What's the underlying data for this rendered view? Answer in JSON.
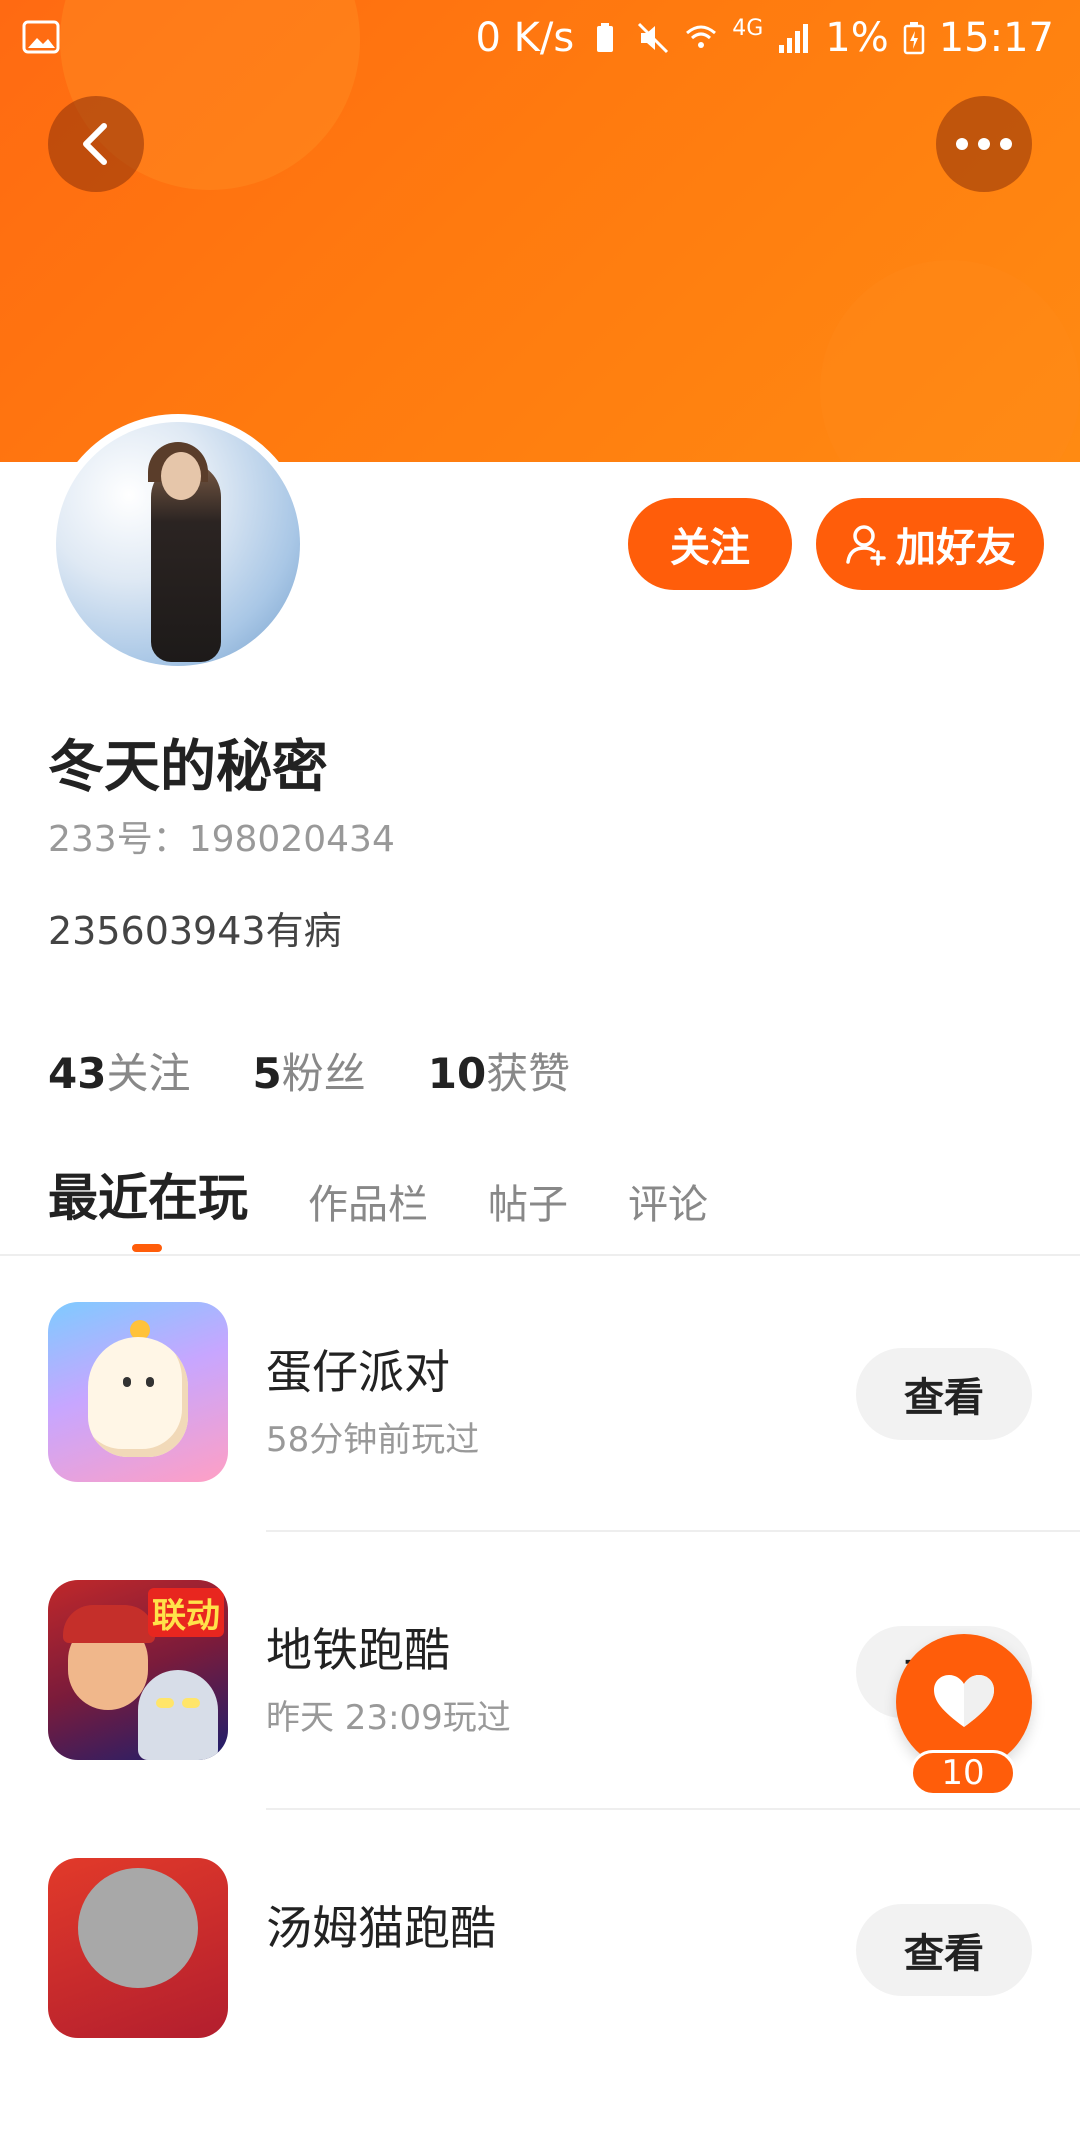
{
  "status_bar": {
    "speed": "0 K/s",
    "network": "4G",
    "battery": "1%",
    "time": "15:17"
  },
  "header": {
    "back_icon": "chevron-left-icon",
    "more_icon": "more-horizontal-icon"
  },
  "profile": {
    "name": "冬天的秘密",
    "id_text": "233号：198020434",
    "bio": "235603943有病",
    "follow_label": "关注",
    "add_friend_label": "加好友",
    "stats": [
      {
        "value": "43",
        "label": "关注"
      },
      {
        "value": "5",
        "label": "粉丝"
      },
      {
        "value": "10",
        "label": "获赞"
      }
    ]
  },
  "tabs": [
    {
      "label": "最近在玩",
      "active": true
    },
    {
      "label": "作品栏",
      "active": false
    },
    {
      "label": "帖子",
      "active": false
    },
    {
      "label": "评论",
      "active": false
    }
  ],
  "games": [
    {
      "name": "蛋仔派对",
      "time": "58分钟前玩过",
      "button": "查看"
    },
    {
      "name": "地铁跑酷",
      "time": "昨天 23:09玩过",
      "button": "查看",
      "icon_badge": "联动"
    },
    {
      "name": "汤姆猫跑酷",
      "time": "",
      "button": "查看"
    }
  ],
  "fab": {
    "count": "10",
    "icon": "heart-icon"
  },
  "colors": {
    "accent": "#ff5d0a",
    "banner": "#ff7a0f"
  }
}
